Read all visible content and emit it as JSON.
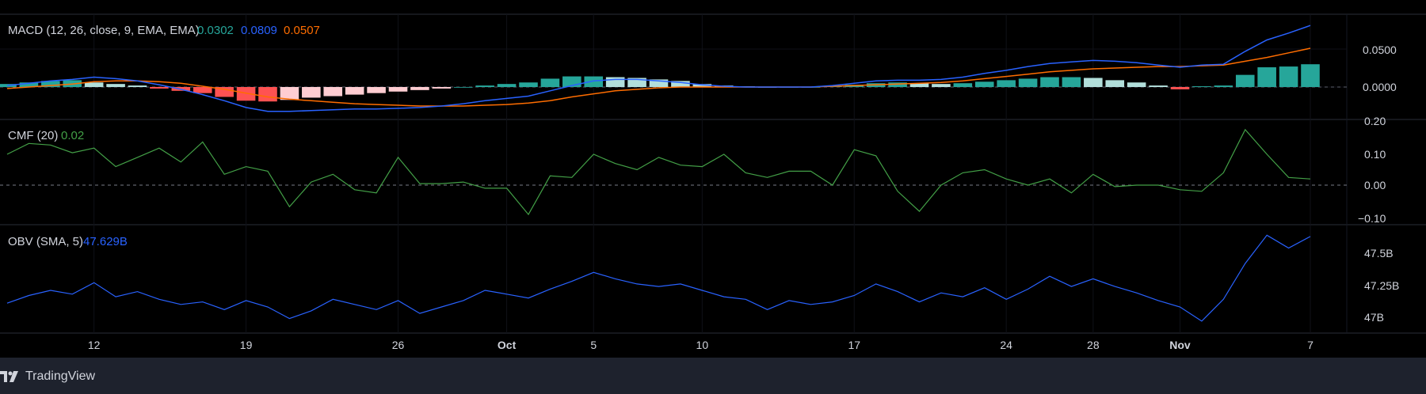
{
  "colors": {
    "background": "#000000",
    "footer": "#1e222d",
    "macd_line": "#2962ff",
    "signal_line": "#ff6d00",
    "hist_pos_grow": "#26a69a",
    "hist_pos_fall": "#b2dfdb",
    "hist_neg_grow": "#ff5252",
    "hist_neg_fall": "#ffcdd2",
    "cmf_line": "#43a047",
    "obv_line": "#2962ff",
    "text": "#d1d4dc"
  },
  "panes": {
    "macd": {
      "label": "MACD (12, 26, close, 9, EMA, EMA)",
      "value_hist": "0.0302",
      "value_macd": "0.0809",
      "value_signal": "0.0507",
      "ticks": [
        "0.0500",
        "0.0000"
      ]
    },
    "cmf": {
      "label": "CMF (20)",
      "value": "0.02",
      "ticks": [
        "0.20",
        "0.10",
        "0.00",
        "−0.10"
      ]
    },
    "obv": {
      "label": "OBV (SMA, 5)",
      "value": "47.629B",
      "ticks": [
        "47.5B",
        "47.25B",
        "47B"
      ]
    }
  },
  "x_axis": {
    "labels": [
      "12",
      "19",
      "26",
      "Oct",
      "5",
      "10",
      "17",
      "24",
      "28",
      "Nov",
      "7"
    ]
  },
  "footer": {
    "brand": "TradingView",
    "logo_icon": "tradingview-logo-icon"
  },
  "chart_data": [
    {
      "type": "bar",
      "name": "MACD histogram",
      "x": [
        8,
        9,
        10,
        11,
        12,
        13,
        14,
        15,
        16,
        17,
        18,
        19,
        20,
        21,
        22,
        23,
        24,
        25,
        26,
        27,
        28,
        29,
        30,
        1,
        2,
        3,
        4,
        5,
        6,
        7,
        8,
        9,
        10,
        11,
        12,
        13,
        14,
        15,
        16,
        17,
        18,
        19,
        20,
        21,
        22,
        23,
        24,
        25,
        26,
        27,
        28,
        29,
        30,
        31,
        1,
        2,
        3,
        4,
        5,
        6,
        7
      ],
      "values": [
        0.004,
        0.006,
        0.008,
        0.009,
        0.006,
        0.004,
        0.002,
        -0.002,
        -0.005,
        -0.008,
        -0.013,
        -0.018,
        -0.019,
        -0.017,
        -0.014,
        -0.012,
        -0.01,
        -0.008,
        -0.006,
        -0.004,
        -0.002,
        0.0,
        0.002,
        0.004,
        0.006,
        0.011,
        0.014,
        0.014,
        0.013,
        0.012,
        0.01,
        0.008,
        0.004,
        0.002,
        0.001,
        0.0,
        0.0,
        0.0,
        0.001,
        0.003,
        0.005,
        0.006,
        0.005,
        0.004,
        0.005,
        0.007,
        0.009,
        0.011,
        0.013,
        0.013,
        0.012,
        0.009,
        0.006,
        0.002,
        -0.003,
        0.001,
        0.002,
        0.016,
        0.026,
        0.027,
        0.03
      ],
      "colors_rule": "TradingView MACD histogram"
    },
    {
      "type": "line",
      "name": "MACD",
      "x": [
        8,
        9,
        10,
        11,
        12,
        13,
        14,
        15,
        16,
        17,
        18,
        19,
        20,
        21,
        22,
        23,
        24,
        25,
        26,
        27,
        28,
        29,
        30,
        1,
        2,
        3,
        4,
        5,
        6,
        7,
        8,
        9,
        10,
        11,
        12,
        13,
        14,
        15,
        16,
        17,
        18,
        19,
        20,
        21,
        22,
        23,
        24,
        25,
        26,
        27,
        28,
        29,
        30,
        31,
        1,
        2,
        3,
        4,
        5,
        6,
        7
      ],
      "values": [
        0.002,
        0.005,
        0.008,
        0.01,
        0.013,
        0.011,
        0.008,
        0.003,
        -0.003,
        -0.01,
        -0.018,
        -0.027,
        -0.032,
        -0.032,
        -0.031,
        -0.03,
        -0.029,
        -0.029,
        -0.028,
        -0.027,
        -0.025,
        -0.022,
        -0.018,
        -0.015,
        -0.012,
        -0.005,
        0.002,
        0.008,
        0.01,
        0.01,
        0.008,
        0.006,
        0.003,
        0.001,
        0.0,
        0.0,
        0.0,
        0.0,
        0.002,
        0.005,
        0.008,
        0.009,
        0.009,
        0.01,
        0.013,
        0.018,
        0.022,
        0.027,
        0.031,
        0.033,
        0.035,
        0.034,
        0.032,
        0.029,
        0.026,
        0.029,
        0.03,
        0.047,
        0.062,
        0.071,
        0.081
      ],
      "ylim": [
        -0.035,
        0.09
      ]
    },
    {
      "type": "line",
      "name": "Signal",
      "x": [
        8,
        9,
        10,
        11,
        12,
        13,
        14,
        15,
        16,
        17,
        18,
        19,
        20,
        21,
        22,
        23,
        24,
        25,
        26,
        27,
        28,
        29,
        30,
        1,
        2,
        3,
        4,
        5,
        6,
        7,
        8,
        9,
        10,
        11,
        12,
        13,
        14,
        15,
        16,
        17,
        18,
        19,
        20,
        21,
        22,
        23,
        24,
        25,
        26,
        27,
        28,
        29,
        30,
        31,
        1,
        2,
        3,
        4,
        5,
        6,
        7
      ],
      "values": [
        -0.002,
        0.0,
        0.002,
        0.004,
        0.007,
        0.008,
        0.008,
        0.007,
        0.005,
        0.001,
        -0.003,
        -0.008,
        -0.013,
        -0.016,
        -0.018,
        -0.02,
        -0.022,
        -0.023,
        -0.024,
        -0.025,
        -0.025,
        -0.025,
        -0.024,
        -0.023,
        -0.021,
        -0.018,
        -0.013,
        -0.009,
        -0.005,
        -0.003,
        -0.001,
        0.0,
        0.0,
        0.0,
        0.0,
        0.0,
        0.0,
        0.0,
        0.001,
        0.002,
        0.003,
        0.004,
        0.005,
        0.006,
        0.008,
        0.011,
        0.014,
        0.017,
        0.02,
        0.022,
        0.024,
        0.025,
        0.026,
        0.027,
        0.027,
        0.028,
        0.029,
        0.034,
        0.039,
        0.045,
        0.051
      ]
    },
    {
      "type": "line",
      "name": "CMF (20)",
      "x": [
        8,
        9,
        10,
        11,
        12,
        13,
        14,
        15,
        16,
        17,
        18,
        19,
        20,
        21,
        22,
        23,
        24,
        25,
        26,
        27,
        28,
        29,
        30,
        1,
        2,
        3,
        4,
        5,
        6,
        7,
        8,
        9,
        10,
        11,
        12,
        13,
        14,
        15,
        16,
        17,
        18,
        19,
        20,
        21,
        22,
        23,
        24,
        25,
        26,
        27,
        28,
        29,
        30,
        31,
        1,
        2,
        3,
        4,
        5,
        6,
        7
      ],
      "values": [
        0.1,
        0.135,
        0.13,
        0.105,
        0.12,
        0.06,
        0.09,
        0.12,
        0.075,
        0.14,
        0.035,
        0.06,
        0.045,
        -0.07,
        0.01,
        0.035,
        -0.015,
        -0.025,
        0.09,
        0.005,
        0.005,
        0.01,
        -0.01,
        -0.01,
        -0.095,
        0.03,
        0.025,
        0.1,
        0.07,
        0.05,
        0.09,
        0.065,
        0.06,
        0.1,
        0.04,
        0.025,
        0.045,
        0.045,
        0.0,
        0.115,
        0.095,
        -0.02,
        -0.085,
        0.0,
        0.04,
        0.05,
        0.02,
        0.0,
        0.02,
        -0.025,
        0.035,
        -0.005,
        0.0,
        0.0,
        -0.015,
        -0.02,
        0.04,
        0.18,
        0.1,
        0.025,
        0.02
      ],
      "ylim": [
        -0.13,
        0.23
      ]
    },
    {
      "type": "line",
      "name": "OBV (SMA, 5)",
      "x": [
        8,
        9,
        10,
        11,
        12,
        13,
        14,
        15,
        16,
        17,
        18,
        19,
        20,
        21,
        22,
        23,
        24,
        25,
        26,
        27,
        28,
        29,
        30,
        1,
        2,
        3,
        4,
        5,
        6,
        7,
        8,
        9,
        10,
        11,
        12,
        13,
        14,
        15,
        16,
        17,
        18,
        19,
        20,
        21,
        22,
        23,
        24,
        25,
        26,
        27,
        28,
        29,
        30,
        31,
        1,
        2,
        3,
        4,
        5,
        6,
        7
      ],
      "values": [
        47.11,
        47.17,
        47.21,
        47.18,
        47.27,
        47.16,
        47.2,
        47.14,
        47.1,
        47.12,
        47.06,
        47.13,
        47.08,
        46.99,
        47.05,
        47.14,
        47.1,
        47.06,
        47.13,
        47.03,
        47.08,
        47.13,
        47.21,
        47.18,
        47.15,
        47.22,
        47.28,
        47.35,
        47.3,
        47.26,
        47.24,
        47.26,
        47.21,
        47.16,
        47.14,
        47.06,
        47.13,
        47.1,
        47.12,
        47.17,
        47.26,
        47.2,
        47.12,
        47.19,
        47.16,
        47.23,
        47.14,
        47.22,
        47.32,
        47.24,
        47.3,
        47.24,
        47.19,
        47.13,
        47.08,
        46.97,
        47.14,
        47.42,
        47.64,
        47.54,
        47.63
      ],
      "ylim": [
        46.93,
        47.68
      ]
    }
  ]
}
